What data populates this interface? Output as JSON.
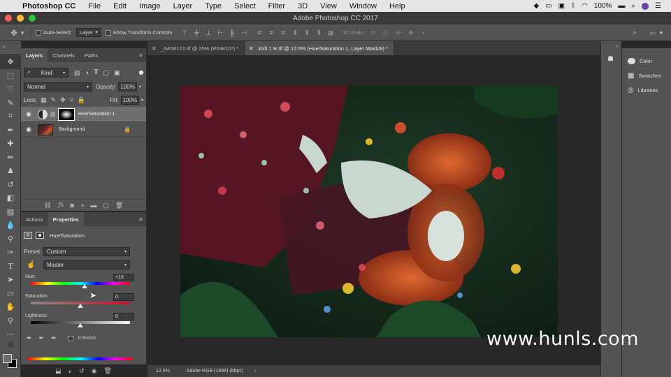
{
  "menubar": {
    "app_name": "Photoshop CC",
    "items": [
      "File",
      "Edit",
      "Image",
      "Layer",
      "Type",
      "Select",
      "Filter",
      "3D",
      "View",
      "Window",
      "Help"
    ],
    "battery": "100%",
    "status_icons": [
      "dropbox-icon",
      "screen-icon",
      "window-icon",
      "bluetooth-icon",
      "wifi-icon",
      "battery-icon",
      "search-icon",
      "avatar-icon",
      "list-icon"
    ]
  },
  "window": {
    "title": "Adobe Photoshop CC 2017"
  },
  "options_bar": {
    "auto_select_label": "Auto-Select:",
    "auto_select_target": "Layer",
    "show_transform_label": "Show Transform Controls",
    "mode_3d_label": "3D Mode:"
  },
  "tabs": [
    {
      "label": "_IMG8172.tif @ 25% (RGB/16*) *",
      "active": false
    },
    {
      "label": "Jodi 1 R.tif @ 12.5% (Hue/Saturation 1, Layer Mask/8) *",
      "active": true
    }
  ],
  "layers_panel": {
    "tabs": [
      "Layers",
      "Channels",
      "Paths"
    ],
    "kind_label": "Kind",
    "blend_mode": "Normal",
    "opacity_label": "Opacity:",
    "opacity_value": "100%",
    "lock_label": "Lock:",
    "fill_label": "Fill:",
    "fill_value": "100%",
    "layers": [
      {
        "name": "Hue/Saturation 1",
        "selected": true
      },
      {
        "name": "Background",
        "selected": false
      }
    ]
  },
  "properties_panel": {
    "tabs": [
      "Actions",
      "Properties"
    ],
    "adjustment_title": "Hue/Saturation",
    "preset_label": "Preset:",
    "preset_value": "Custom",
    "channel_value": "Master",
    "hue_label": "Hue:",
    "hue_value": "+16",
    "saturation_label": "Saturation:",
    "saturation_value": "0",
    "lightness_label": "Lightness:",
    "lightness_value": "0",
    "colorize_label": "Colorize",
    "hue_pos": 0.544,
    "saturation_pos": 0.5,
    "lightness_pos": 0.5
  },
  "status_bar": {
    "zoom": "12.5%",
    "profile": "Adobe RGB (1998) (8bpc)"
  },
  "right_panel": {
    "items": [
      {
        "label": "Color",
        "icon": "color-icon"
      },
      {
        "label": "Swatches",
        "icon": "swatches-icon"
      },
      {
        "label": "Libraries",
        "icon": "libraries-icon"
      }
    ]
  },
  "watermark": "www.hunls.com",
  "colors": {
    "panel_bg": "#535353",
    "workspace_bg": "#282828",
    "close_button": "#ff5f57",
    "minimize_button": "#febc2e",
    "maximize_button": "#28c840"
  }
}
